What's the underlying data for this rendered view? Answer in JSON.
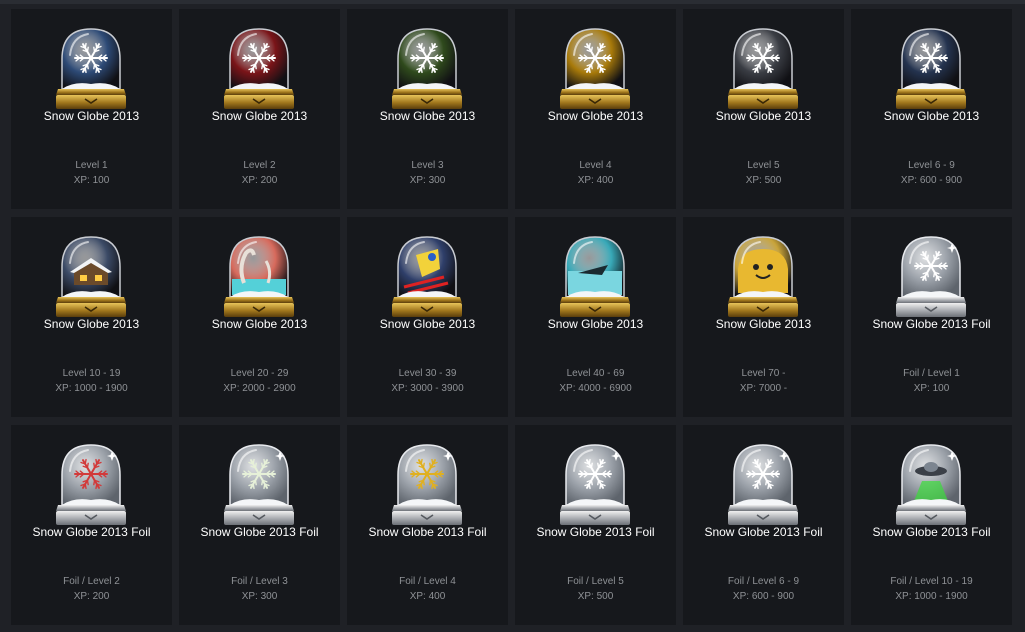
{
  "badges": [
    {
      "name": "Snow Globe 2013",
      "level": "Level 1",
      "xp": "XP: 100",
      "foil": false,
      "color": "#2d4a76",
      "icon": "snowflake-icon"
    },
    {
      "name": "Snow Globe 2013",
      "level": "Level 2",
      "xp": "XP: 200",
      "foil": false,
      "color": "#7a1418",
      "icon": "snowflake-icon"
    },
    {
      "name": "Snow Globe 2013",
      "level": "Level 3",
      "xp": "XP: 300",
      "foil": false,
      "color": "#2f4a1c",
      "icon": "snowflake-icon"
    },
    {
      "name": "Snow Globe 2013",
      "level": "Level 4",
      "xp": "XP: 400",
      "foil": false,
      "color": "#a87a0a",
      "icon": "snowflake-icon"
    },
    {
      "name": "Snow Globe 2013",
      "level": "Level 5",
      "xp": "XP: 500",
      "foil": false,
      "color": "#3a3d44",
      "icon": "snowflake-icon"
    },
    {
      "name": "Snow Globe 2013",
      "level": "Level 6 - 9",
      "xp": "XP: 600 - 900",
      "foil": false,
      "color": "#24334f",
      "icon": "snowflake-icon"
    },
    {
      "name": "Snow Globe 2013",
      "level": "Level 10 - 19",
      "xp": "XP: 1000 - 1900",
      "foil": false,
      "color": "#3b4a66",
      "icon": "cabin-icon"
    },
    {
      "name": "Snow Globe 2013",
      "level": "Level 20 - 29",
      "xp": "XP: 2000 - 2900",
      "foil": false,
      "color": "#d76a5c",
      "icon": "kraken-icon"
    },
    {
      "name": "Snow Globe 2013",
      "level": "Level 30 - 39",
      "xp": "XP: 3000 - 3900",
      "foil": false,
      "color": "#2f3f6a",
      "icon": "skier-icon"
    },
    {
      "name": "Snow Globe 2013",
      "level": "Level 40 - 69",
      "xp": "XP: 4000 - 6900",
      "foil": false,
      "color": "#38a9b8",
      "icon": "shark-fin-icon"
    },
    {
      "name": "Snow Globe 2013",
      "level": "Level 70 -",
      "xp": "XP: 7000 -",
      "foil": false,
      "color": "#c9a43a",
      "icon": "yeti-icon"
    },
    {
      "name": "Snow Globe 2013 Foil",
      "level": "Foil / Level 1",
      "xp": "XP: 100",
      "foil": true,
      "color": "#ffffff",
      "icon": "snowflake-icon"
    },
    {
      "name": "Snow Globe 2013 Foil",
      "level": "Foil / Level 2",
      "xp": "XP: 200",
      "foil": true,
      "color": "#d23a3a",
      "icon": "snowflake-icon"
    },
    {
      "name": "Snow Globe 2013 Foil",
      "level": "Foil / Level 3",
      "xp": "XP: 300",
      "foil": true,
      "color": "#e6f0d8",
      "icon": "snowflake-icon"
    },
    {
      "name": "Snow Globe 2013 Foil",
      "level": "Foil / Level 4",
      "xp": "XP: 400",
      "foil": true,
      "color": "#e0b020",
      "icon": "snowflake-icon"
    },
    {
      "name": "Snow Globe 2013 Foil",
      "level": "Foil / Level 5",
      "xp": "XP: 500",
      "foil": true,
      "color": "#ffffff",
      "icon": "snowflake-icon"
    },
    {
      "name": "Snow Globe 2013 Foil",
      "level": "Foil / Level 6 - 9",
      "xp": "XP: 600 - 900",
      "foil": true,
      "color": "#ffffff",
      "icon": "snowflake-icon"
    },
    {
      "name": "Snow Globe 2013 Foil",
      "level": "Foil / Level 10 - 19",
      "xp": "XP: 1000 - 1900",
      "foil": true,
      "color": "#4ad04a",
      "icon": "ufo-icon"
    }
  ]
}
